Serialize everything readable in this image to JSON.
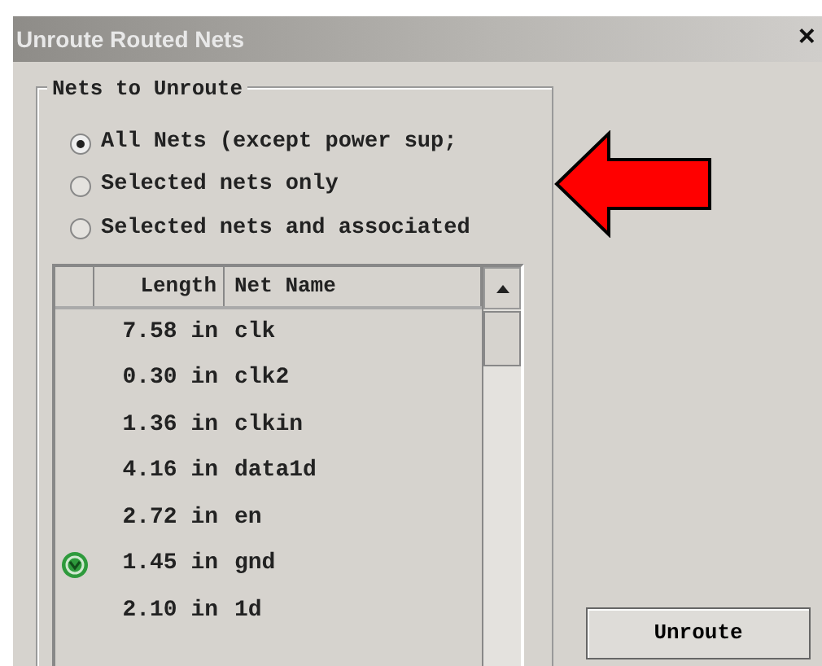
{
  "window": {
    "title": "Unroute Routed Nets",
    "close": "×"
  },
  "group": {
    "label": "Nets to Unroute",
    "options": [
      {
        "label": "All Nets (except power sup;",
        "selected": true
      },
      {
        "label": "Selected nets only",
        "selected": false
      },
      {
        "label": "Selected nets and associated",
        "selected": false
      }
    ]
  },
  "table": {
    "columns": [
      "Length",
      "Net Name"
    ],
    "rows": [
      {
        "length": "7.58 in",
        "net": "clk",
        "marked": false
      },
      {
        "length": "0.30 in",
        "net": "clk2",
        "marked": false
      },
      {
        "length": "1.36 in",
        "net": "clkin",
        "marked": false
      },
      {
        "length": "4.16 in",
        "net": "data1d",
        "marked": false
      },
      {
        "length": "2.72 in",
        "net": "en",
        "marked": false
      },
      {
        "length": "1.45 in",
        "net": "gnd",
        "marked": true
      },
      {
        "length": "2.10 in",
        "net": "1d",
        "marked": false
      }
    ]
  },
  "buttons": [
    "Unroute"
  ]
}
